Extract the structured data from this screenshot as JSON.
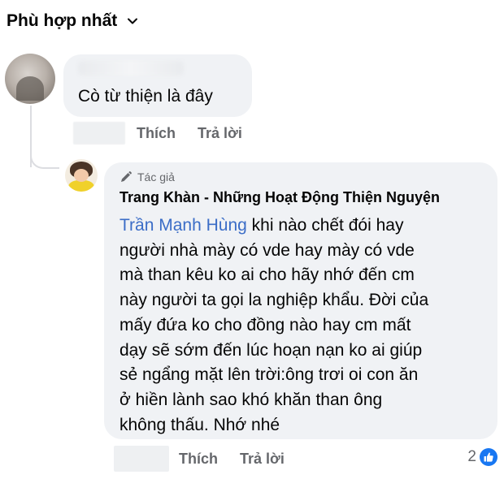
{
  "sort": {
    "label": "Phù hợp nhất",
    "icon": "chevron-down-icon"
  },
  "comment1": {
    "text": "Cò từ thiện là đây",
    "actions": {
      "like": "Thích",
      "reply": "Trả lời"
    }
  },
  "comment2": {
    "author_badge": "Tác giả",
    "author_name": "Trang Khàn - Những Hoạt Động Thiện Nguyện",
    "mention": "Trần Mạnh Hùng",
    "lines": [
      " khi nào chết đói hay",
      "người nhà mày có vde hay mày có vde",
      "mà than kêu ko ai cho hãy nhớ đến cm",
      "này người ta gọi la nghiệp khẩu. Đời của",
      "mấy đứa ko cho đồng nào hay cm mất",
      "dạy sẽ sớm đến lúc hoạn nạn ko ai giúp",
      "sẻ ngẩng mặt lên trời:ông trơi oi con ăn",
      "ở hiền lành sao khó khăn than ông",
      "không thấu. Nhớ nhé"
    ],
    "actions": {
      "like": "Thích",
      "reply": "Trả lời"
    },
    "reaction_count": "2",
    "reaction_icon": "thumbs-up-icon"
  },
  "colors": {
    "link": "#3b6dc7",
    "bubble": "#f0f2f5",
    "muted": "#65676b",
    "like_blue": "#1877f2"
  }
}
